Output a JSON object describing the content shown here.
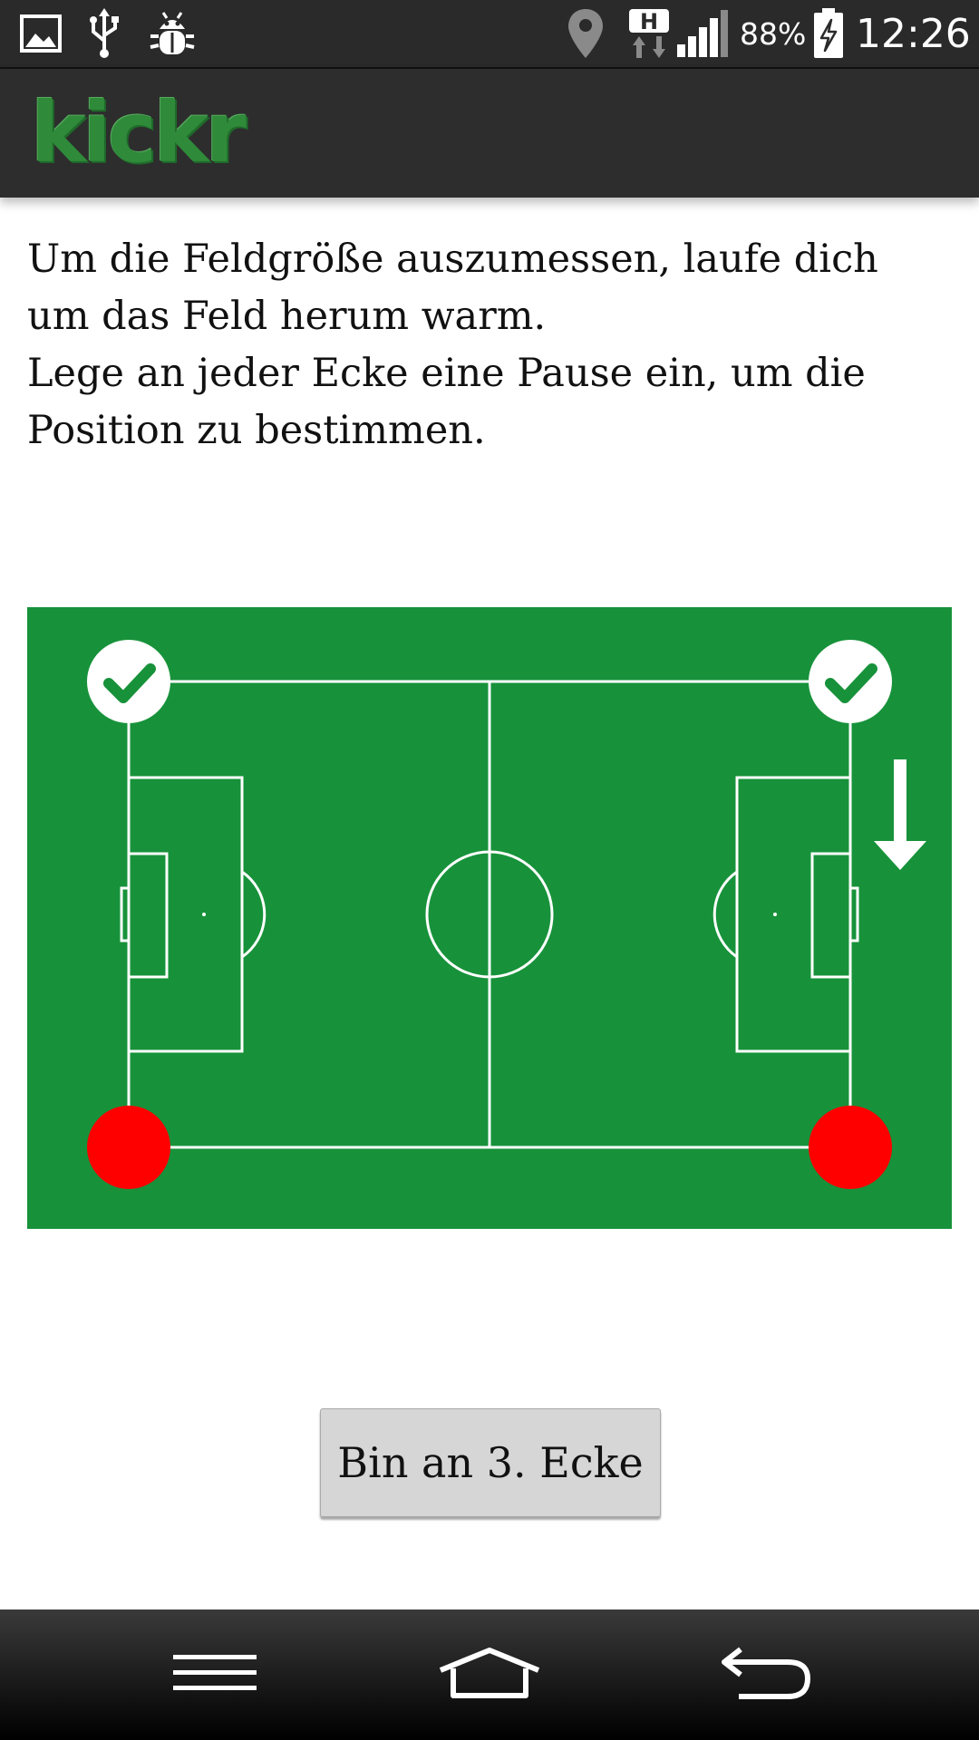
{
  "status_bar": {
    "battery": "88%",
    "time": "12:26",
    "network_type": "H",
    "icons": [
      "gallery-icon",
      "usb-icon",
      "debug-bug-icon",
      "location-icon",
      "network-h-icon",
      "signal-icon",
      "battery-charging-icon"
    ]
  },
  "app_bar": {
    "logo_text": "kickr"
  },
  "instructions": {
    "line1": "Um die Feldgröße auszumessen, laufe dich um das Feld herum warm.",
    "line2": "Lege an jeder Ecke eine Pause ein, um die Position zu bestimmen."
  },
  "field": {
    "color": "#17923a",
    "corners": [
      {
        "name": "top-left",
        "status": "done"
      },
      {
        "name": "top-right",
        "status": "done"
      },
      {
        "name": "bottom-right",
        "status": "pending"
      },
      {
        "name": "bottom-left",
        "status": "pending"
      }
    ],
    "direction": "down-arrow-icon",
    "done_color": "#ffffff",
    "check_color": "#17923a",
    "pending_color": "#ff0000"
  },
  "action_button": {
    "label": "Bin an 3. Ecke"
  },
  "nav_bar": {
    "icons": [
      "menu-icon",
      "home-icon",
      "back-icon"
    ]
  }
}
